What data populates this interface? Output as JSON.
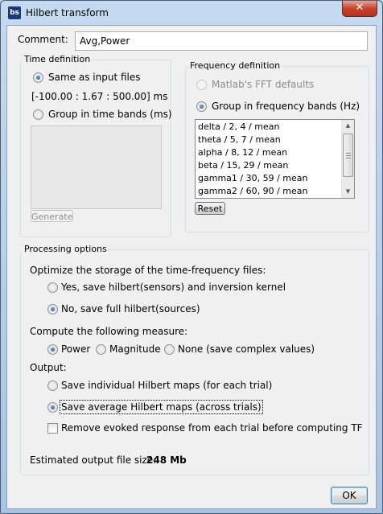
{
  "window": {
    "title": "Hilbert transform",
    "app_icon_text": "bs",
    "close_glyph": "✕"
  },
  "comment": {
    "label": "Comment:",
    "value": "Avg,Power"
  },
  "time_definition": {
    "legend": "Time definition",
    "same_as_input": "Same as input files",
    "time_range": "[-100.00 : 1.67 : 500.00]  ms",
    "group_time_bands": "Group in time bands (ms)",
    "generate_button": "Generate"
  },
  "frequency_definition": {
    "legend": "Frequency definition",
    "matlab_fft": "Matlab's FFT defaults",
    "group_freq_bands": "Group in frequency bands (Hz)",
    "bands": [
      "delta / 2, 4 / mean",
      "theta / 5, 7 / mean",
      "alpha / 8, 12 / mean",
      "beta / 15, 29 / mean",
      "gamma1 / 30, 59 / mean",
      "gamma2 / 60, 90 / mean"
    ],
    "reset_button": "Reset"
  },
  "processing": {
    "legend": "Processing options",
    "optimize_label": "Optimize the storage of the time-frequency files:",
    "opt_yes": "Yes, save hilbert(sensors) and inversion kernel",
    "opt_no": "No, save full hilbert(sources)",
    "measure_label": "Compute the following measure:",
    "measure_power": "Power",
    "measure_magnitude": "Magnitude",
    "measure_none": "None (save complex values)",
    "output_label": "Output:",
    "output_individual": "Save individual Hilbert maps (for each trial)",
    "output_average": "Save average Hilbert maps (across trials)",
    "remove_evoked": "Remove evoked response from each trial before computing TF",
    "file_size_label": "Estimated output file size:",
    "file_size_value": "248 Mb"
  },
  "ok_button": "OK"
}
